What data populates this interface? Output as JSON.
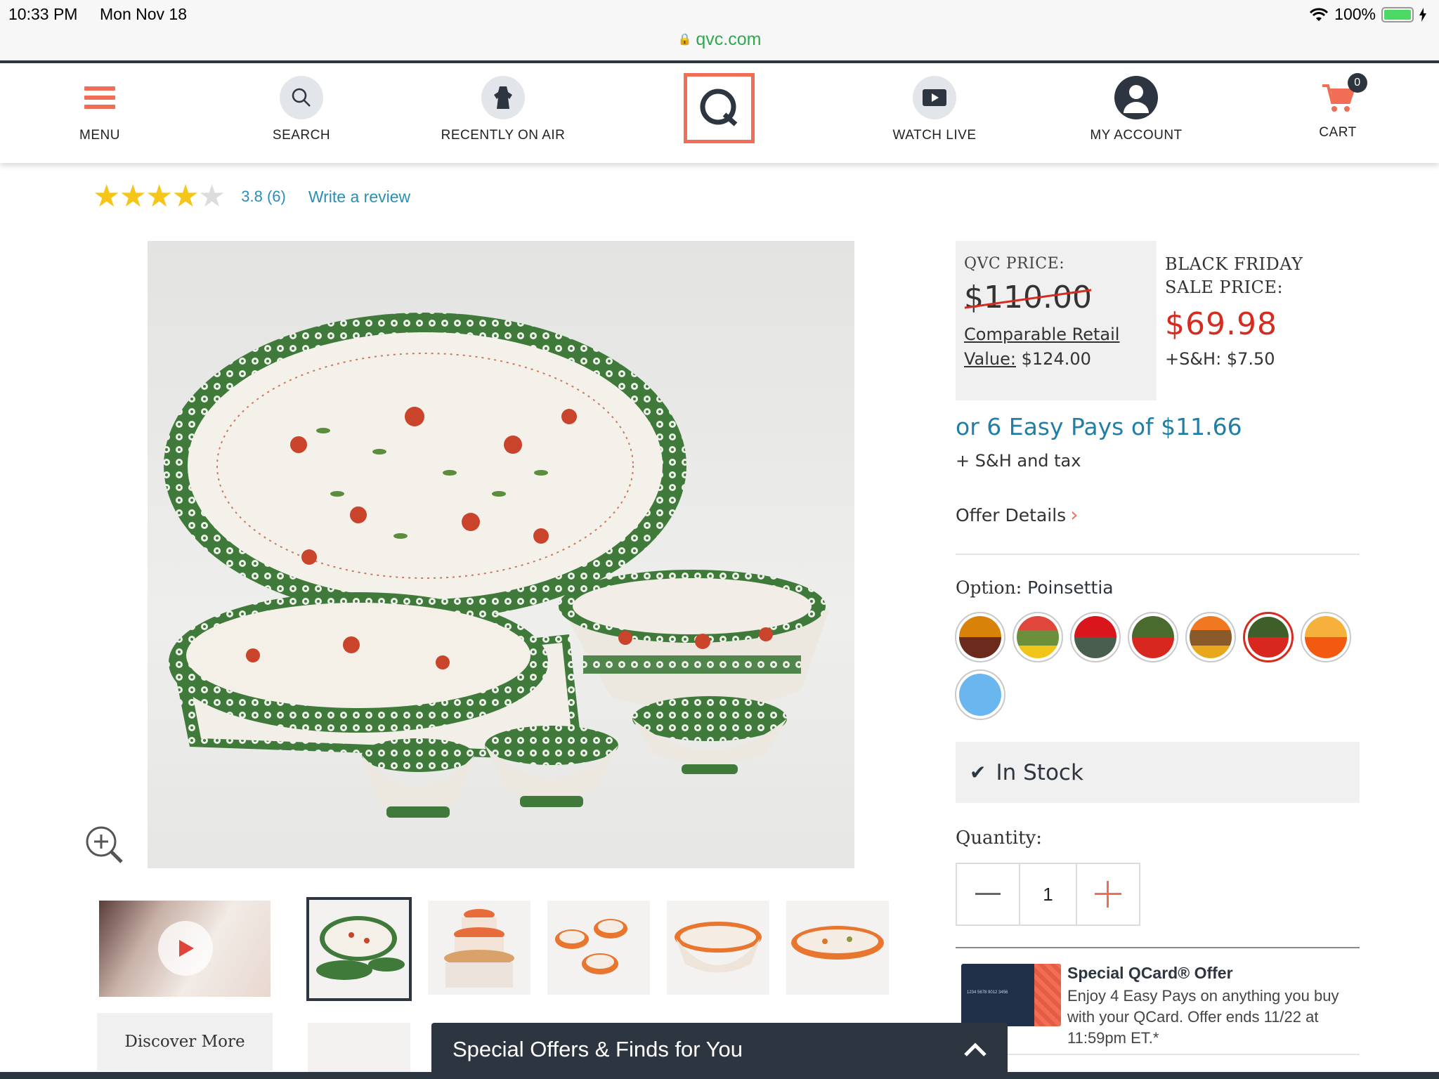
{
  "status_bar": {
    "time": "10:33 PM",
    "date": "Mon Nov 18",
    "battery": "100%"
  },
  "browser": {
    "url": "qvc.com"
  },
  "nav": {
    "menu": "MENU",
    "search": "SEARCH",
    "recently_on_air": "RECENTLY ON AIR",
    "watch_live": "WATCH LIVE",
    "my_account": "MY ACCOUNT",
    "cart": "CART",
    "cart_count": "0"
  },
  "product": {
    "rating_value": 3.8,
    "rating_text": "3.8 (6)",
    "write_review": "Write a review",
    "stars_filled": 4,
    "thumbnails": [
      "video",
      "main-set",
      "stacked-bowls",
      "small-bowls",
      "large-bowl",
      "oval-baker"
    ]
  },
  "discover_more": "Discover More",
  "pricing": {
    "qvc_price_label": "QVC PRICE:",
    "qvc_price": "$110.00",
    "comp_retail_label": "Comparable Retail Value:",
    "comp_retail_prefix": "Comparable Retail",
    "comp_retail_value_word": "Value:",
    "comp_retail_value": "$124.00",
    "sale_label_line1": "BLACK FRIDAY",
    "sale_label_line2": "SALE PRICE:",
    "sale_price": "$69.98",
    "sh": "+S&H: $7.50",
    "easy_pays": "or 6 Easy Pays of $11.66",
    "sh_tax": "+ S&H and tax",
    "offer_details": "Offer Details"
  },
  "option": {
    "label": "Option:",
    "selected": "Poinsettia",
    "swatches": [
      {
        "top": "#d9820a",
        "bottom": "#6b2a1b",
        "selected": false
      },
      {
        "top": "#e0463c",
        "mid": "#6b8f3a",
        "bottom": "#f0c419",
        "selected": false
      },
      {
        "top": "#d8161b",
        "bottom": "#4a5e4f",
        "selected": false
      },
      {
        "top": "#4a6b2e",
        "bottom": "#d8271f",
        "selected": false
      },
      {
        "top": "#f07820",
        "mid": "#8a5a2b",
        "bottom": "#e8a71c",
        "selected": false
      },
      {
        "top": "#3f5f2a",
        "bottom": "#d8271f",
        "selected": true
      },
      {
        "top": "#f5b13c",
        "bottom": "#f25a12",
        "selected": false
      },
      {
        "top": "#6ab7ef",
        "bottom": "#6ab7ef",
        "selected": false
      }
    ]
  },
  "stock": {
    "text": "In Stock"
  },
  "quantity": {
    "label": "Quantity:",
    "value": "1"
  },
  "qcard": {
    "title": "Special QCard® Offer",
    "body": "Enjoy 4 Easy Pays on anything you buy with your QCard. Offer ends 11/22 at 11:59pm ET.*",
    "card_text": "1234 5678 9012 3456"
  },
  "offers_bar": {
    "label": "Special Offers & Finds for You"
  }
}
